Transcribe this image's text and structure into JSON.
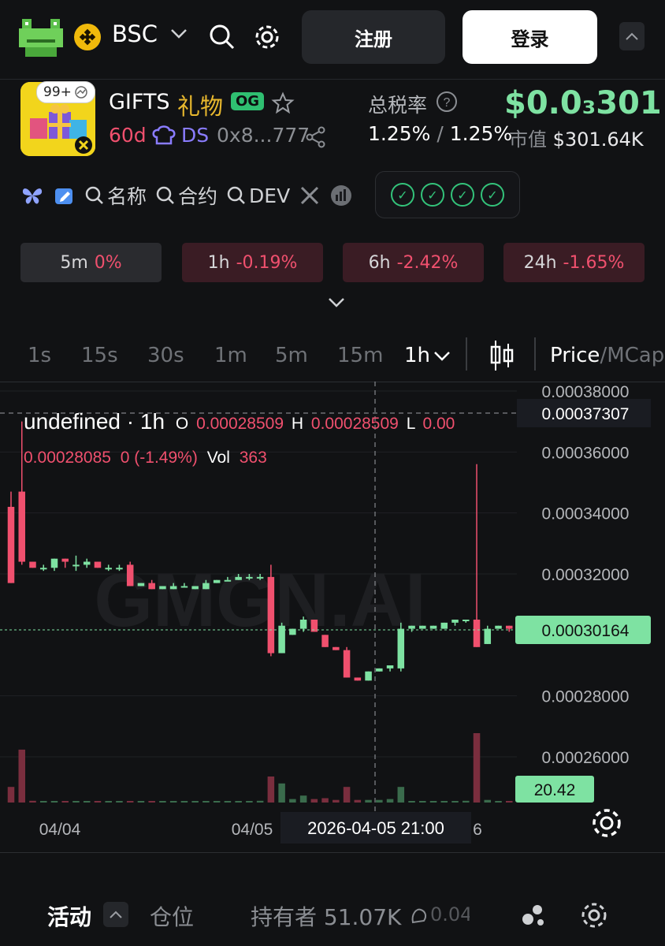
{
  "header": {
    "chain": "BSC",
    "register_label": "注册",
    "login_label": "登录"
  },
  "token": {
    "symbol": "GIFTS",
    "name": "礼物",
    "og_badge": "OG",
    "notif_count": "99+",
    "age": "60d",
    "ds_label": "DS",
    "address": "0x8...777",
    "tax_label": "总税率",
    "tax_buy": "1.25%",
    "tax_sep": "/",
    "tax_sell": "1.25%",
    "price": "$0.0₃301",
    "mcap_label": "市值",
    "mcap_value": "$301.64K"
  },
  "links": {
    "name_search": "名称",
    "contract_search": "合约",
    "dev_search": "DEV"
  },
  "changes": [
    {
      "period": "5m",
      "value": "0%"
    },
    {
      "period": "1h",
      "value": "-0.19%"
    },
    {
      "period": "6h",
      "value": "-2.42%"
    },
    {
      "period": "24h",
      "value": "-1.65%"
    }
  ],
  "intervals": [
    "1s",
    "15s",
    "30s",
    "1m",
    "5m",
    "15m",
    "1h"
  ],
  "active_interval": "1h",
  "price_mcap": {
    "price": "Price",
    "sep": "/",
    "mcap": "MCap"
  },
  "chart_data": {
    "type": "candlestick",
    "legend_line1": {
      "title": "undefined · 1h",
      "o_label": "O",
      "o": "0.00028509",
      "h_label": "H",
      "h": "0.00028509",
      "l_label": "L",
      "l": "0.00"
    },
    "legend_line2": {
      "c": "0.00028085",
      "chg": "0 (-1.49%)",
      "vol_label": "Vol",
      "vol": "363"
    },
    "y_ticks": [
      "0.00038000",
      "0.00036000",
      "0.00034000",
      "0.00032000",
      "0.00028000",
      "0.00026000"
    ],
    "ylim": [
      0.00025,
      0.00039
    ],
    "x_ticks": [
      "04/04",
      "04/05",
      "6"
    ],
    "crosshair_time": "2026-04-05 21:00",
    "hover_price": "0.00037307",
    "last_price": "0.00030164",
    "volume_label": "20.42",
    "watermark": "GMGN.AI",
    "candles": [
      [
        0.000342,
        0.000347,
        0.000317,
        0.000317
      ],
      [
        0.000347,
        0.00037,
        0.000323,
        0.000324
      ],
      [
        0.000324,
        0.000324,
        0.000322,
        0.000322
      ],
      [
        0.000322,
        0.000323,
        0.000321,
        0.000322
      ],
      [
        0.000322,
        0.000325,
        0.000321,
        0.000325
      ],
      [
        0.000325,
        0.000325,
        0.000322,
        0.000324
      ],
      [
        0.000323,
        0.000326,
        0.000321,
        0.000323
      ],
      [
        0.000323,
        0.000325,
        0.000322,
        0.000324
      ],
      [
        0.000324,
        0.000324,
        0.000322,
        0.000322
      ],
      [
        0.000322,
        0.000323,
        0.000321,
        0.000322
      ],
      [
        0.000322,
        0.000323,
        0.000321,
        0.000322
      ],
      [
        0.000323,
        0.000324,
        0.000316,
        0.000316
      ],
      [
        0.000316,
        0.000317,
        0.000316,
        0.000317
      ],
      [
        0.000317,
        0.000318,
        0.000315,
        0.000315
      ],
      [
        0.000315,
        0.000316,
        0.000315,
        0.000316
      ],
      [
        0.000315,
        0.000317,
        0.000315,
        0.000316
      ],
      [
        0.000316,
        0.000317,
        0.000316,
        0.000316
      ],
      [
        0.000315,
        0.000316,
        0.000315,
        0.000316
      ],
      [
        0.000315,
        0.000318,
        0.000315,
        0.000317
      ],
      [
        0.000317,
        0.000318,
        0.000317,
        0.000318
      ],
      [
        0.000318,
        0.000319,
        0.000318,
        0.000318
      ],
      [
        0.000318,
        0.00032,
        0.000318,
        0.000319
      ],
      [
        0.000319,
        0.00032,
        0.000318,
        0.000319
      ],
      [
        0.000319,
        0.00032,
        0.000318,
        0.000319
      ],
      [
        0.000319,
        0.000323,
        0.000293,
        0.000294
      ],
      [
        0.000294,
        0.000304,
        0.000294,
        0.000303
      ],
      [
        0.0003,
        0.000302,
        0.0003,
        0.000302
      ],
      [
        0.000302,
        0.000306,
        0.000301,
        0.000305
      ],
      [
        0.000305,
        0.000305,
        0.000301,
        0.000301
      ],
      [
        0.0003,
        0.0003,
        0.000296,
        0.000296
      ],
      [
        0.000296,
        0.000296,
        0.000295,
        0.000295
      ],
      [
        0.000295,
        0.000296,
        0.000286,
        0.000286
      ],
      [
        0.000286,
        0.000286,
        0.000285,
        0.000285
      ],
      [
        0.000285,
        0.000288,
        0.000285,
        0.000288
      ],
      [
        0.000288,
        0.000289,
        0.000288,
        0.000289
      ],
      [
        0.000289,
        0.00029,
        0.000288,
        0.00029
      ],
      [
        0.000289,
        0.000304,
        0.000288,
        0.000302
      ],
      [
        0.000302,
        0.000303,
        0.000301,
        0.000303
      ],
      [
        0.000302,
        0.000303,
        0.000302,
        0.000303
      ],
      [
        0.000302,
        0.000303,
        0.000302,
        0.000303
      ],
      [
        0.000302,
        0.000304,
        0.000302,
        0.000304
      ],
      [
        0.000304,
        0.000305,
        0.000303,
        0.000305
      ],
      [
        0.000305,
        0.000305,
        0.000304,
        0.000305
      ],
      [
        0.000305,
        0.000356,
        0.000296,
        0.000296
      ],
      [
        0.000297,
        0.000303,
        0.000297,
        0.000302
      ],
      [
        0.000302,
        0.000303,
        0.000302,
        0.000303
      ],
      [
        0.000303,
        0.000303,
        0.000301,
        0.000302
      ]
    ],
    "volumes": [
      0.18,
      0.61,
      0.02,
      0.01,
      0.01,
      0.01,
      0.01,
      0.01,
      0.01,
      0.01,
      0.01,
      0.01,
      0.01,
      0.01,
      0.01,
      0.01,
      0.01,
      0.01,
      0.01,
      0.01,
      0.01,
      0.01,
      0.01,
      0.02,
      0.3,
      0.22,
      0.04,
      0.08,
      0.04,
      0.05,
      0.03,
      0.18,
      0.03,
      0.03,
      0.03,
      0.04,
      0.18,
      0.01,
      0.01,
      0.01,
      0.01,
      0.01,
      0.02,
      0.8,
      0.03,
      0.01,
      0.01
    ]
  },
  "bottom_tabs": {
    "activity": "活动",
    "positions": "仓位",
    "holders": "持有者 51.07K",
    "extra": "0.04"
  },
  "colors": {
    "up": "#7ee2a2",
    "down": "#f0506e",
    "bg": "#111214"
  }
}
